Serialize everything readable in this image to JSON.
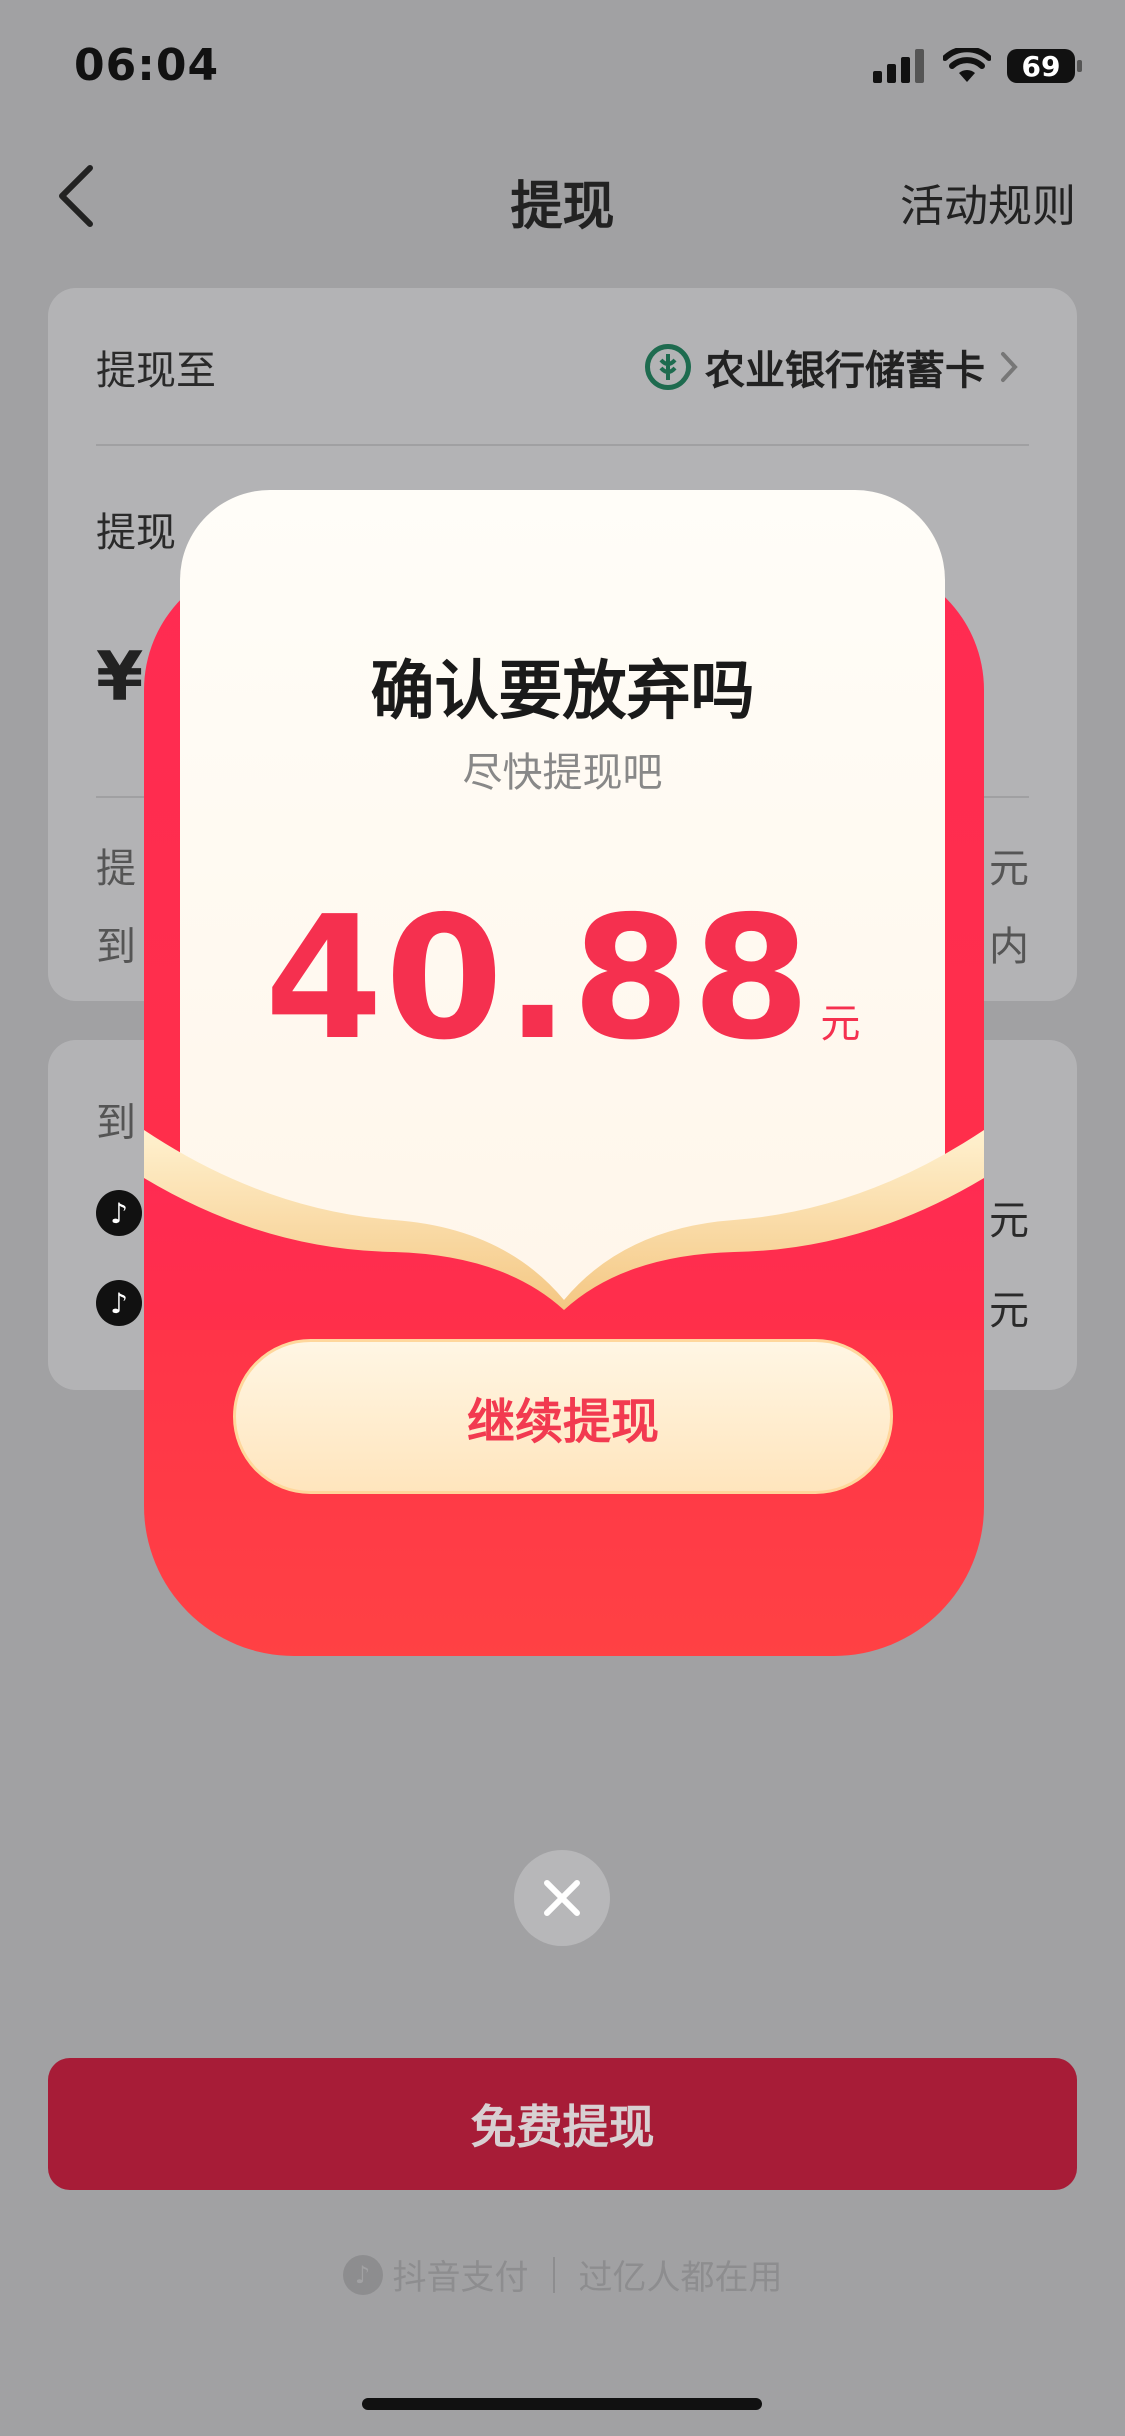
{
  "status_bar": {
    "time": "06:04",
    "battery": "69"
  },
  "nav": {
    "title": "提现",
    "rules_label": "活动规则"
  },
  "card_main": {
    "withdraw_to_label": "提现至",
    "bank_name": "农业银行储蓄卡",
    "amount_label_partial": "提现",
    "currency_partial": "¥",
    "info_left_1": "提",
    "info_left_2": "到",
    "info_right_1": "元",
    "info_right_2": "内"
  },
  "card_second": {
    "header_partial": "到",
    "row1_right": "元",
    "row2_right": "元"
  },
  "popup": {
    "title": "确认要放弃吗",
    "subtitle": "尽快提现吧",
    "amount": "40.88",
    "unit": "元",
    "continue_label": "继续提现"
  },
  "bottom": {
    "free_withdraw_label": "免费提现",
    "footer_brand": "抖音支付",
    "footer_tagline": "过亿人都在用"
  },
  "colors": {
    "accent_red": "#f5304f",
    "gold": "#ffd79c",
    "overlay_gray": "#a1a1a3",
    "primary_btn": "#a71c37"
  }
}
